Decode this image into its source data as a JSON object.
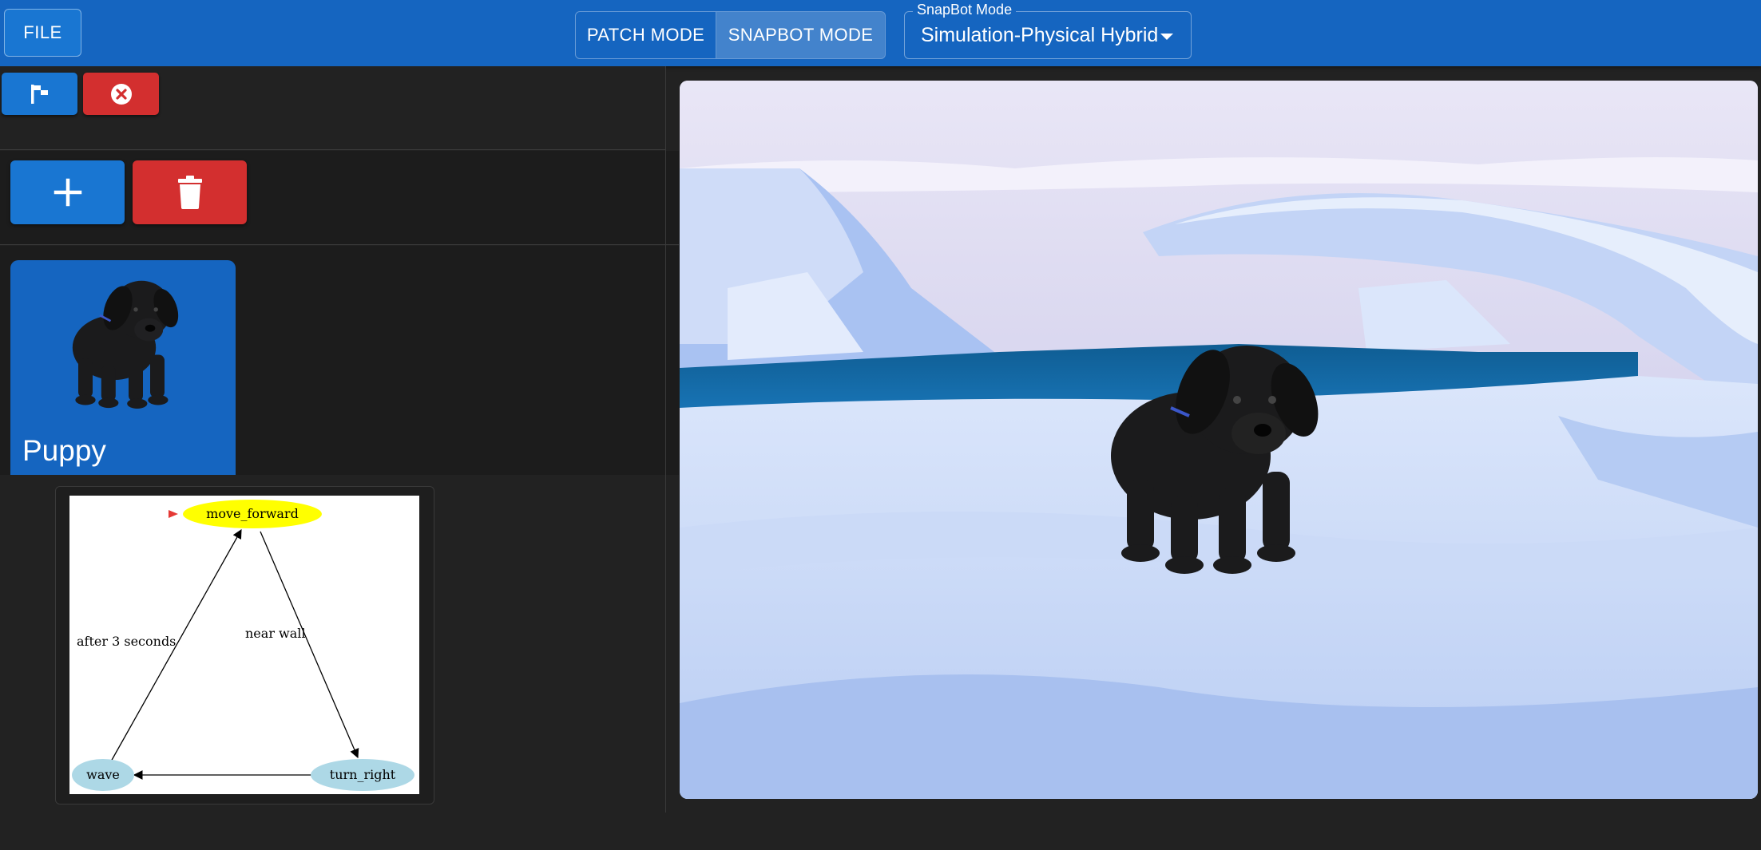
{
  "toolbar": {
    "file_label": "FILE",
    "modes": [
      {
        "label": "PATCH MODE",
        "selected": false
      },
      {
        "label": "SNAPBOT MODE",
        "selected": true
      }
    ],
    "snapbot_select": {
      "legend": "SnapBot Mode",
      "value": "Simulation-Physical Hybrid"
    }
  },
  "controls": {
    "run_icon": "flag-icon",
    "stop_icon": "close-circle-icon",
    "add_icon": "plus-icon",
    "delete_icon": "trash-icon"
  },
  "sprites": [
    {
      "name": "Puppy",
      "selected": true
    }
  ],
  "state_machine": {
    "initial_state": "move_forward",
    "states": [
      {
        "name": "move_forward",
        "color": "#ffff00"
      },
      {
        "name": "turn_right",
        "color": "#add8e6"
      },
      {
        "name": "wave",
        "color": "#add8e6"
      }
    ],
    "transitions": [
      {
        "from": "move_forward",
        "to": "turn_right",
        "label": "near wall"
      },
      {
        "from": "turn_right",
        "to": "wave",
        "label": ""
      },
      {
        "from": "wave",
        "to": "move_forward",
        "label": "after 3 seconds"
      }
    ]
  },
  "stage": {
    "backdrop": "arctic ice scene",
    "sprite": "Puppy"
  },
  "colors": {
    "appbar": "#1565c0",
    "primary": "#1976d2",
    "danger": "#d32f2f",
    "background": "#222222"
  }
}
